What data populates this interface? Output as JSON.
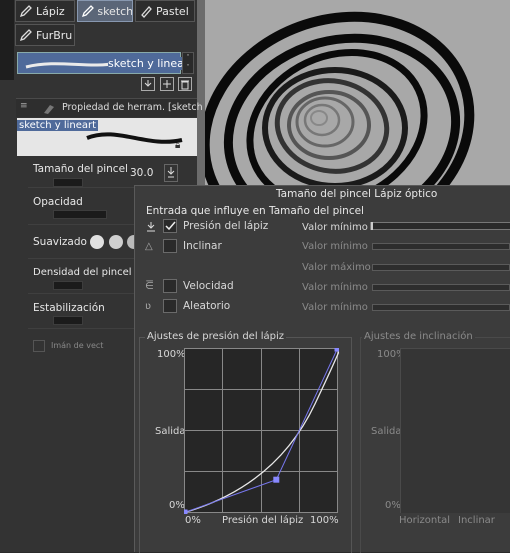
{
  "tools": {
    "tabs": [
      {
        "label": "Lápiz",
        "icon": "pencil-icon"
      },
      {
        "label": "sketch",
        "icon": "pencil-sketch-icon"
      },
      {
        "label": "Pastel",
        "icon": "pastel-icon"
      },
      {
        "label": "FurBru",
        "icon": "fur-brush-icon"
      }
    ],
    "selected_preset": "sketch y lineart"
  },
  "tool_property": {
    "header": "Propiedad de herram. [sketch",
    "preview_label": "sketch y lineart",
    "brush_size_label": "Tamaño del pincel",
    "brush_size_value": "30.0",
    "opacity_label": "Opacidad",
    "smoothing_label": "Suavizado",
    "density_label": "Densidad del pincel",
    "stabilization_label": "Estabilización",
    "magnet_label": "Imán de vect"
  },
  "popup": {
    "title": "Tamaño del pincel Lápiz óptico",
    "section_label": "Entrada que influye en Tamaño del pincel",
    "inputs": [
      {
        "label": "Presión del lápiz",
        "checked": true,
        "icon": "pressure-icon",
        "min_label": "Valor mínimo",
        "active": true
      },
      {
        "label": "Inclinar",
        "checked": false,
        "icon": "tilt-icon",
        "min_label": "Valor mínimo",
        "max_label": "Valor máximo",
        "active": false
      },
      {
        "label": "Velocidad",
        "checked": false,
        "icon": "velocity-icon",
        "min_label": "Valor mínimo",
        "active": false
      },
      {
        "label": "Aleatorio",
        "checked": false,
        "icon": "random-icon",
        "min_label": "Valor mínimo",
        "active": false
      }
    ],
    "pressure_graph": {
      "title": "Ajustes de presión del lápiz",
      "y_top": "100%",
      "y_mid": "Salida",
      "y_bottom": "0%",
      "x_left": "0%",
      "x_mid": "Presión del lápiz",
      "x_right": "100%",
      "curve_points": [
        [
          0,
          0
        ],
        [
          0.6,
          0.2
        ],
        [
          1,
          1
        ]
      ]
    },
    "tilt_graph": {
      "title": "Ajustes de inclinación",
      "y_top": "100%",
      "y_mid": "Salida",
      "y_bottom": "0%",
      "x_left": "Horizontal",
      "x_right": "Inclinar"
    }
  },
  "colors": {
    "panel": "#333333",
    "popup": "#3c3c3c",
    "canvas": "#a8a8a8",
    "curve_point": "#8888ff"
  }
}
